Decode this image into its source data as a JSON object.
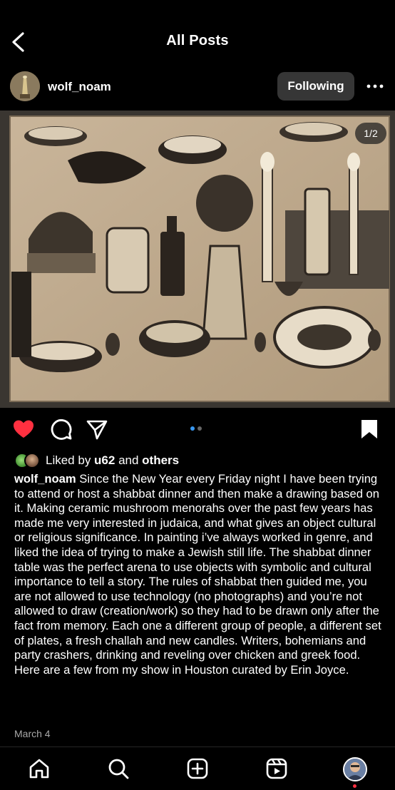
{
  "header": {
    "title": "All Posts"
  },
  "post": {
    "username": "wolf_noam",
    "follow_label": "Following",
    "image_counter": "1/2",
    "carousel": {
      "count": 2,
      "active": 0
    },
    "likes": {
      "prefix": "Liked by ",
      "user": "u62",
      "middle": " and ",
      "others": "others"
    },
    "caption": "Since the New Year every Friday night I have been trying to attend or host a shabbat dinner and then make a drawing based on it. Making ceramic mushroom menorahs over the past few years has made me very interested in judaica, and what gives an object cultural or religious significance. In painting i’ve always worked in genre, and liked the idea of trying to make a Jewish still life. The shabbat dinner table was the perfect arena to use objects with symbolic and cultural importance to tell a story. The rules of shabbat then guided me, you are not allowed to use technology (no photographs) and you’re not allowed to draw (creation/work) so they had to be drawn only after the fact from memory.  Each one a different group of people, a different set of plates, a fresh challah and new candles. Writers, bohemians and party crashers, drinking and reveling over chicken and greek food. Here are a few from my show in Houston curated by Erin Joyce.",
    "date": "March 4"
  },
  "icons": {
    "back": "chevron-left-icon",
    "more": "ellipsis-icon",
    "like": "heart-icon",
    "comment": "comment-icon",
    "share": "paper-plane-icon",
    "save": "bookmark-icon",
    "tabs": [
      "home-icon",
      "search-icon",
      "create-icon",
      "reels-icon",
      "profile-avatar"
    ]
  },
  "colors": {
    "background": "#000000",
    "like": "#ff3040",
    "carousel_active": "#3897f0",
    "button": "#363636"
  }
}
